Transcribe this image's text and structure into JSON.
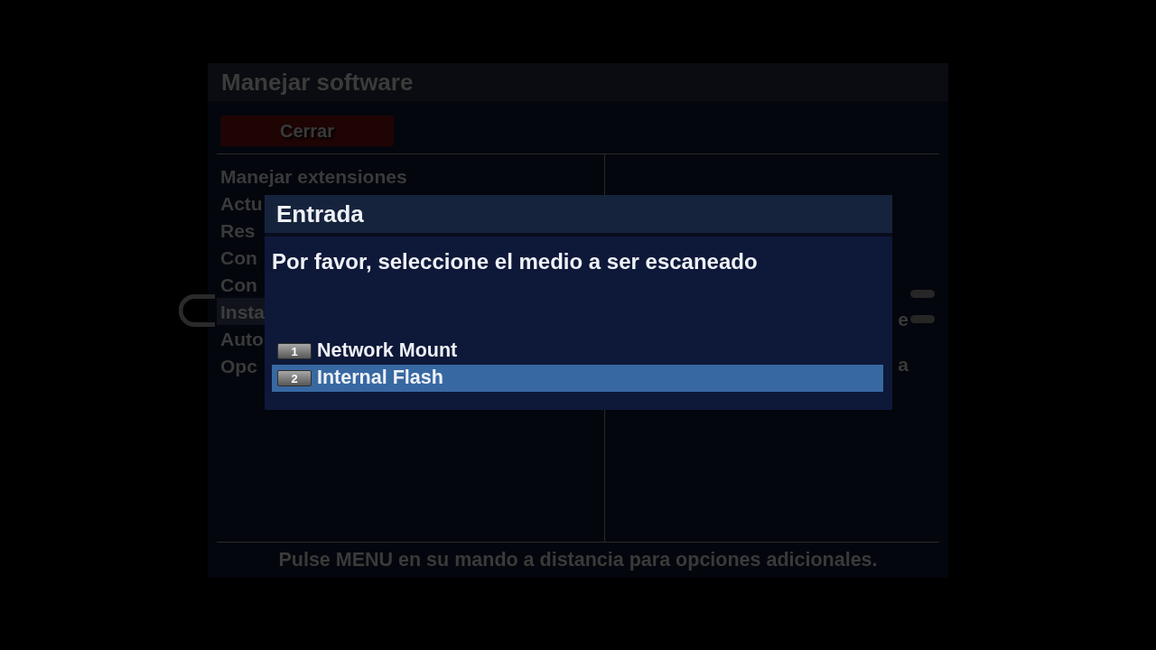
{
  "window": {
    "title": "Manejar software"
  },
  "close_button": {
    "label": "Cerrar"
  },
  "menu": {
    "items": [
      {
        "label": "Manejar extensiones",
        "selected": false
      },
      {
        "label": "Actu",
        "selected": false
      },
      {
        "label": "Res",
        "selected": false
      },
      {
        "label": "Con",
        "selected": false
      },
      {
        "label": "Con",
        "selected": false
      },
      {
        "label": "Insta",
        "selected": true
      },
      {
        "label": "Auto",
        "selected": false
      },
      {
        "label": "Opc",
        "selected": false
      }
    ]
  },
  "description_fragments": [
    "e",
    "a"
  ],
  "footer": {
    "hint": "Pulse MENU en su mando a distancia para opciones adicionales."
  },
  "dialog": {
    "title": "Entrada",
    "message": "Por favor, seleccione el medio a ser escaneado",
    "options": [
      {
        "key": "1",
        "label": "Network Mount",
        "selected": false
      },
      {
        "key": "2",
        "label": "Internal Flash",
        "selected": true
      }
    ]
  }
}
